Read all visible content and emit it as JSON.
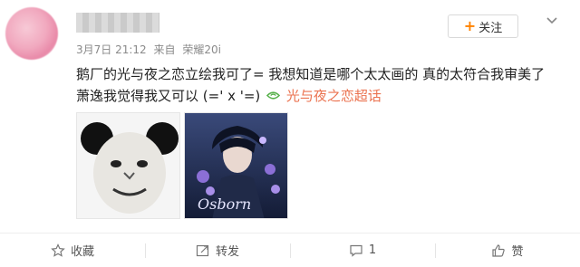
{
  "post": {
    "time": "3月7日 21:12",
    "source_prefix": "来自",
    "device": "荣耀20i",
    "follow_label": "关注",
    "text_line1": "鹅厂的光与夜之恋立绘我可了= 我想知道是哪个太太画的 真的太符合我审美了",
    "text_line2": "萧逸我觉得我又可以 (=' x '=)",
    "topic_label": "光与夜之恋超话",
    "image2_caption": "Osborn"
  },
  "actions": {
    "favorite_label": "收藏",
    "repost_label": "转发",
    "comment_count": "1",
    "like_label": "赞"
  },
  "colors": {
    "accent": "#ff8200",
    "topic": "#eb7350"
  },
  "icons": [
    "chevron-down-icon",
    "plus-icon",
    "topic-icon",
    "star-icon",
    "repost-icon",
    "comment-icon",
    "like-icon"
  ]
}
